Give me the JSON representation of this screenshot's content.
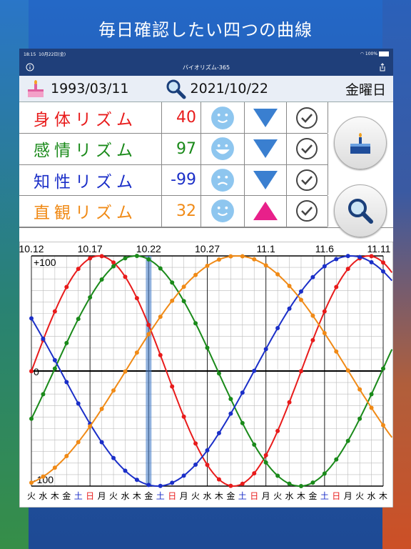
{
  "banner": {
    "title": "毎日確認したい四つの曲線"
  },
  "status": {
    "time": "18:15",
    "date": "10月22日(金)",
    "battery": "100%"
  },
  "nav": {
    "title": "バイオリズム-365",
    "info_icon": "info-icon",
    "share_icon": "share-icon"
  },
  "dates": {
    "birth": "1993/03/11",
    "target": "2021/10/22",
    "weekday": "金曜日"
  },
  "rhythms": [
    {
      "label": "身体リズム",
      "value": "40",
      "color": "#e81b1b",
      "face": "smile",
      "trend": "down"
    },
    {
      "label": "感情リズム",
      "value": "97",
      "color": "#1a8a1a",
      "face": "grin",
      "trend": "down"
    },
    {
      "label": "知性リズム",
      "value": "-99",
      "color": "#1b2fc8",
      "face": "sad",
      "trend": "down"
    },
    {
      "label": "直観リズム",
      "value": "32",
      "color": "#f08a16",
      "face": "smile",
      "trend": "up"
    }
  ],
  "buttons": {
    "birthday": "cake-icon",
    "search": "search-icon"
  },
  "chart_data": {
    "type": "line",
    "x_labels": [
      "10.12",
      "10.17",
      "10.22",
      "10.27",
      "11.1",
      "11.6",
      "11.11"
    ],
    "y_labels": [
      "+100",
      "0",
      "-100"
    ],
    "ylim": [
      -100,
      100
    ],
    "highlight_day": "10.22",
    "weekdays": [
      "火",
      "水",
      "木",
      "金",
      "土",
      "日",
      "月",
      "火",
      "水",
      "木",
      "金",
      "土",
      "日",
      "月",
      "火",
      "水",
      "木",
      "金",
      "土",
      "日",
      "月",
      "火",
      "水",
      "木",
      "金",
      "土",
      "日",
      "月",
      "火",
      "水",
      "木"
    ],
    "series": [
      {
        "color": "#e81b1b",
        "period": 23,
        "value_at_day0": 40,
        "trend": "down"
      },
      {
        "color": "#1a8a1a",
        "period": 28,
        "value_at_day0": 97,
        "trend": "down"
      },
      {
        "color": "#1b2fc8",
        "period": 33,
        "value_at_day0": -99,
        "trend": "down"
      },
      {
        "color": "#f08a16",
        "period": 38,
        "value_at_day0": 32,
        "trend": "up"
      }
    ]
  }
}
